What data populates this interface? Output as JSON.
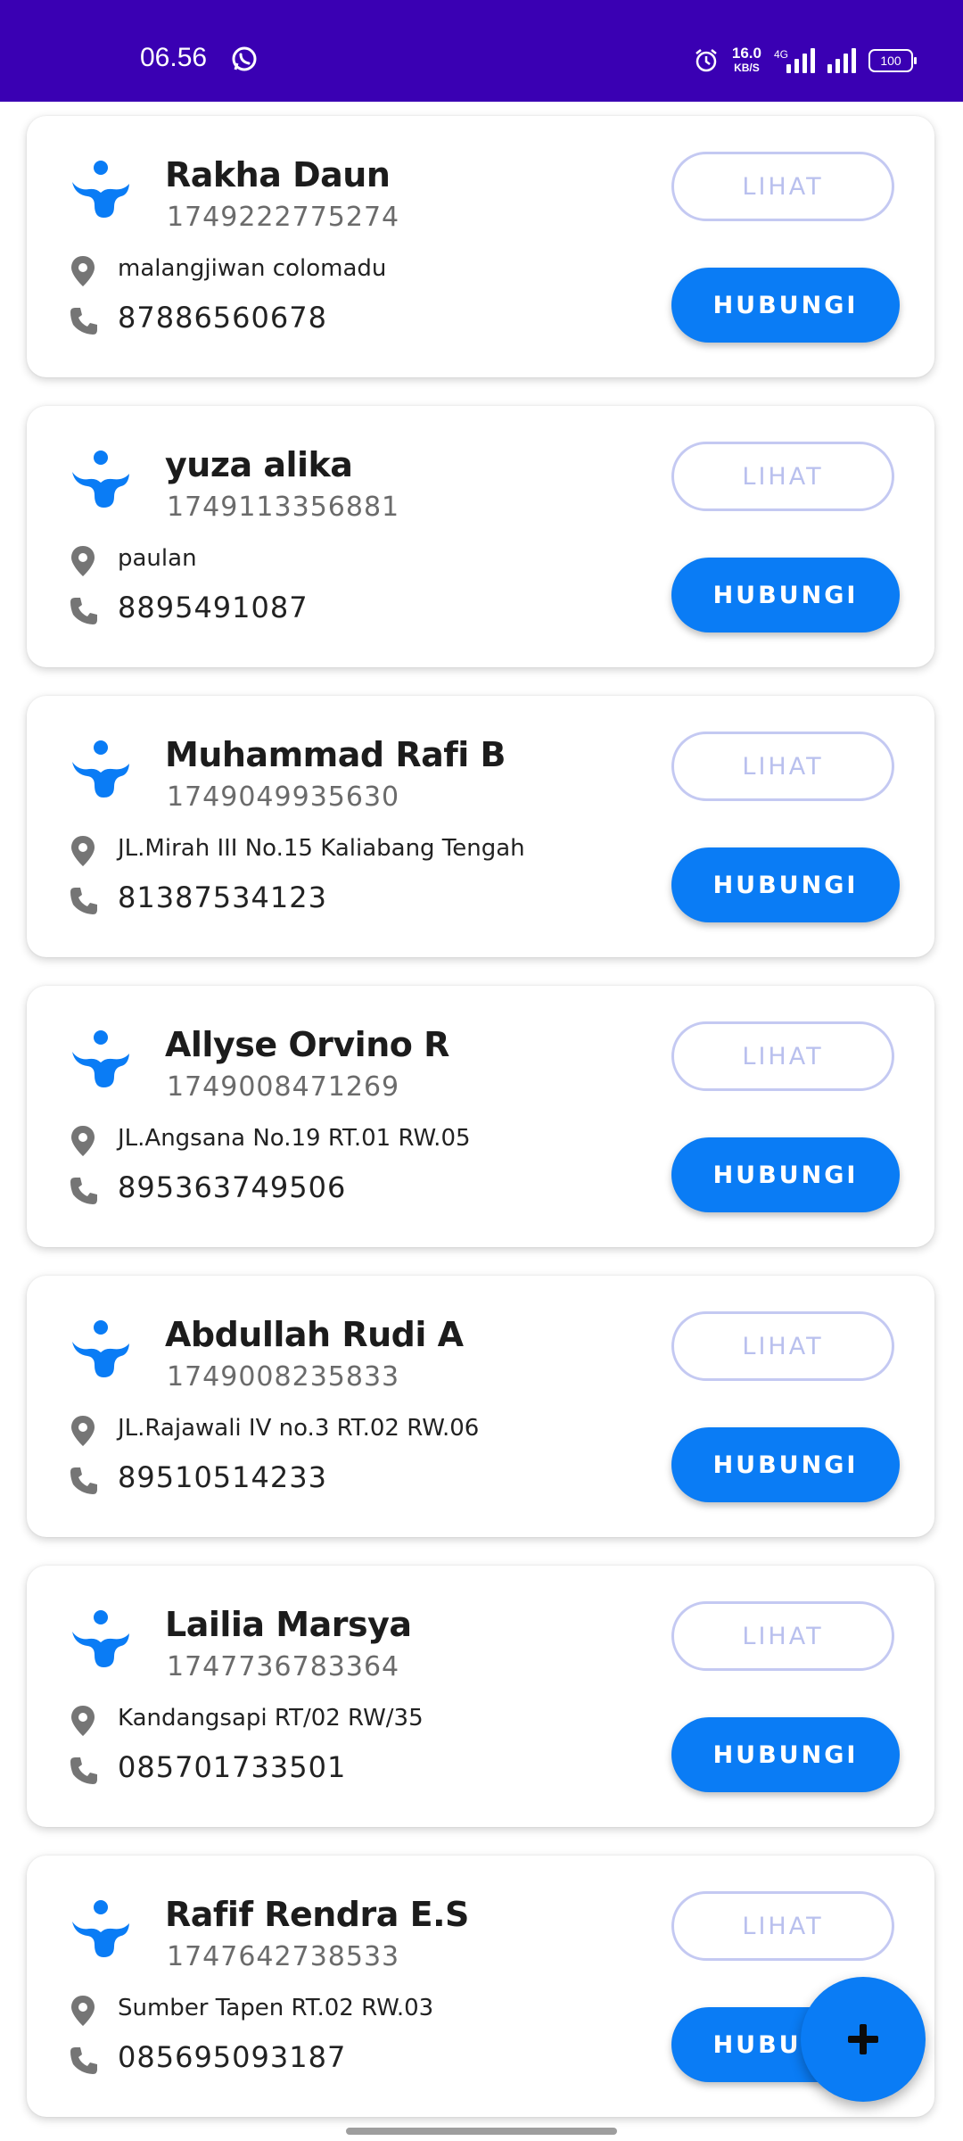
{
  "status_bar": {
    "time": "06.56",
    "speed_value": "16.0",
    "speed_unit": "KB/S",
    "network_label": "4G",
    "battery": "100",
    "background_color": "#3a00b3"
  },
  "buttons": {
    "view_label": "LIHAT",
    "contact_label": "HUBUNGI"
  },
  "contacts": [
    {
      "name": "Rakha Daun",
      "id": "1749222775274",
      "address": "malangjiwan colomadu",
      "phone": "87886560678"
    },
    {
      "name": "yuza alika",
      "id": "1749113356881",
      "address": "paulan",
      "phone": "8895491087"
    },
    {
      "name": "Muhammad Rafi B",
      "id": "1749049935630",
      "address": "JL.Mirah III No.15 Kaliabang Tengah",
      "phone": "81387534123"
    },
    {
      "name": "Allyse Orvino R",
      "id": "1749008471269",
      "address": "JL.Angsana No.19 RT.01 RW.05",
      "phone": "895363749506"
    },
    {
      "name": "Abdullah Rudi A",
      "id": "1749008235833",
      "address": "JL.Rajawali IV no.3 RT.02 RW.06",
      "phone": "89510514233"
    },
    {
      "name": "Lailia Marsya",
      "id": "1747736783364",
      "address": "Kandangsapi RT/02 RW/35",
      "phone": "085701733501"
    },
    {
      "name": "Rafif Rendra E.S",
      "id": "1747642738533",
      "address": "Sumber Tapen RT.02 RW.03",
      "phone": "085695093187"
    }
  ],
  "fab": {
    "icon": "plus-icon"
  },
  "colors": {
    "primary": "#0a7cf5",
    "outline": "#c4c9f2",
    "icon_gray": "#757575"
  }
}
